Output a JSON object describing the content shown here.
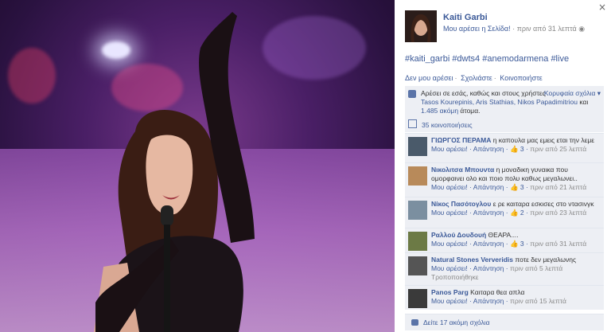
{
  "window": {
    "close_glyph": "×"
  },
  "post": {
    "author": "Kaiti Garbi",
    "like_page": "Μου αρέσει η Σελίδα!",
    "time": "πριν από 31 λεπτά",
    "caption": "#kaiti_garbi #dwts4 #anemodarmena #live",
    "actions": [
      "Δεν μου αρέσει",
      "Σχολιάστε",
      "Κοινοποιήστε"
    ],
    "likes_text_prefix": "Αρέσει σε εσάς, καθώς και στους χρήστες",
    "likes_people": "Tasos Kourepinis, Aris Stathias, Nikos Papadimitriou",
    "likes_and": "και",
    "likes_others": "1.485 ακόμη",
    "likes_suffix": "άτομα.",
    "top_comments": "Κορυφαία σχόλια ▾",
    "shares": "35 κοινοποιήσεις"
  },
  "comments": [
    {
      "name": "ΓΙΩΡΓΟΣ ΠΕΡΑΜΑ",
      "text": "η καπουλα μας εμεις εται την λεμε",
      "like": "Μου αρέσει!",
      "reply": "Απάντηση",
      "likes": "3",
      "time": "πριν από 25 λεπτά",
      "edited": "",
      "avatar_color": "#4a5a6a"
    },
    {
      "name": "Νικολιτσα Μπουντα",
      "text": "η μοναδικη γυναικα που ομορφαινει ολο και ποιο πολυ καθως μεγαλωνει..",
      "like": "Μου αρέσει!",
      "reply": "Απάντηση",
      "likes": "3",
      "time": "πριν από 21 λεπτά",
      "edited": "",
      "avatar_color": "#b88a5a"
    },
    {
      "name": "Νίκος Πασότογλου",
      "text": "ε ρε καιταρα εσκισες στο ντασινγκ",
      "like": "Μου αρέσει!",
      "reply": "Απάντηση",
      "likes": "2",
      "time": "πριν από 23 λεπτά",
      "edited": "",
      "avatar_color": "#7b8fa0"
    },
    {
      "name": "Ραλλού Δουδουή",
      "text": "ΘΕΑΡΑ....",
      "like": "Μου αρέσει!",
      "reply": "Απάντηση",
      "likes": "3",
      "time": "πριν από 31 λεπτά",
      "edited": "",
      "avatar_color": "#6c7a45"
    },
    {
      "name": "Natural Stones Ververidis",
      "text": "ποτε δεν μεγαλωνης",
      "like": "Μου αρέσει!",
      "reply": "Απάντηση",
      "likes": "",
      "time": "πριν από 5 λεπτά",
      "edited": "Τροποποιήθηκε",
      "avatar_color": "#555555"
    },
    {
      "name": "Panos Parg",
      "text": "Καιταρα θεα απλα",
      "like": "Μου αρέσει!",
      "reply": "Απάντηση",
      "likes": "",
      "time": "πριν από 15 λεπτά",
      "edited": "",
      "avatar_color": "#3a3a3a"
    }
  ],
  "more_comments": "Δείτε 17 ακόμη σχόλια"
}
